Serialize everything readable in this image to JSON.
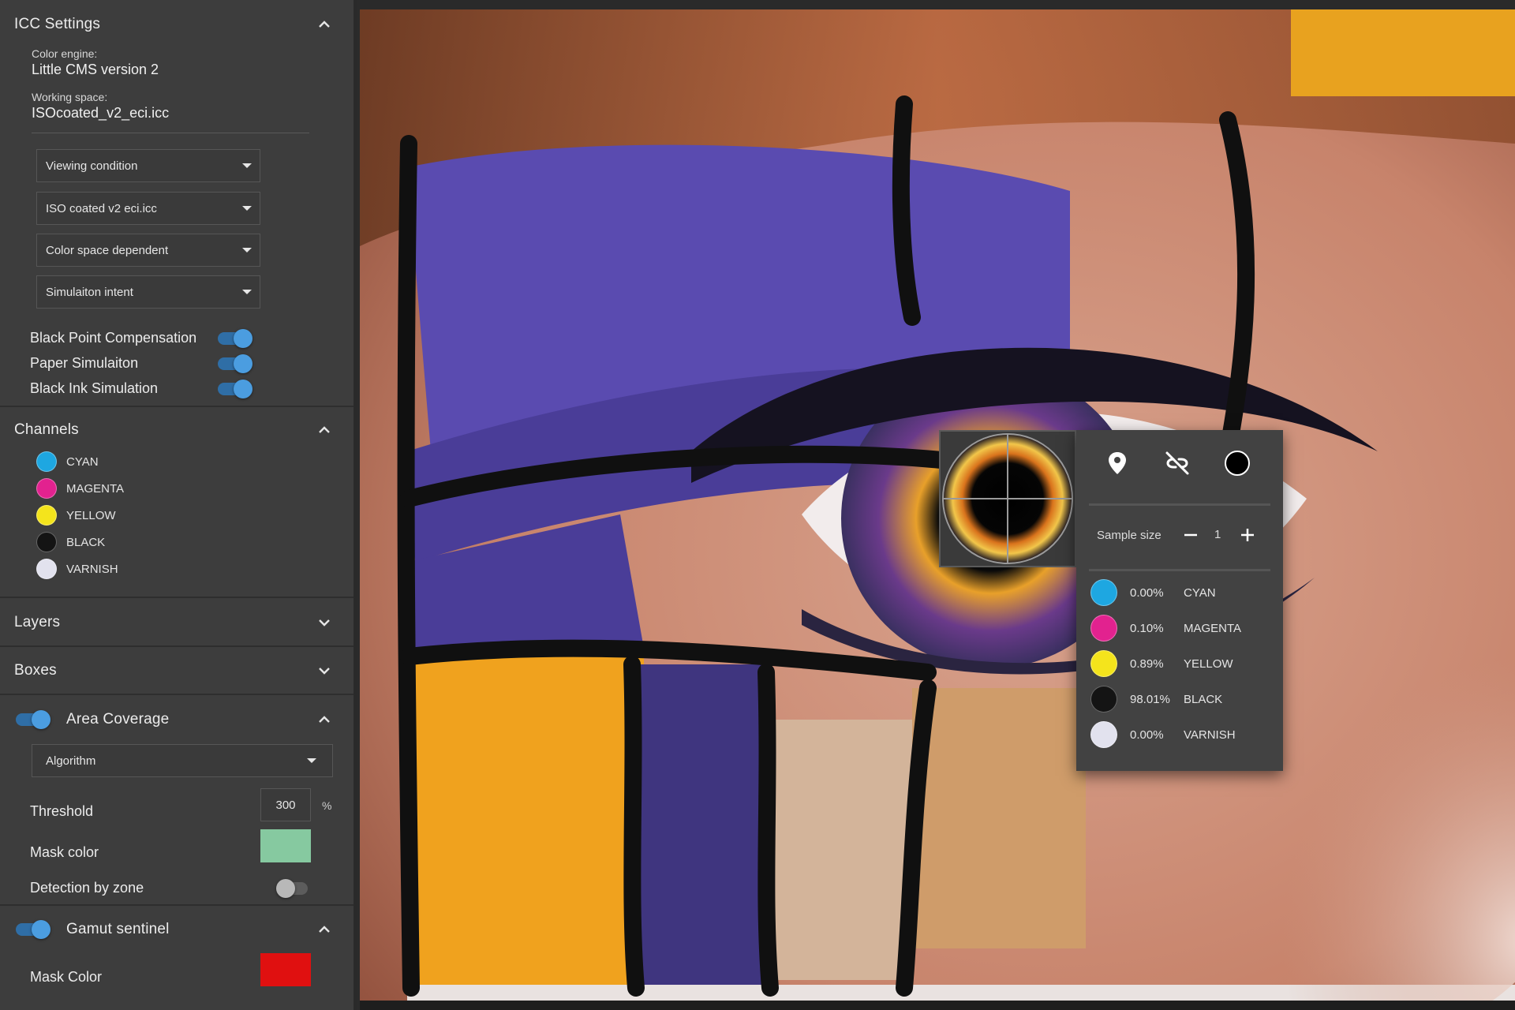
{
  "icc": {
    "title": "ICC Settings",
    "engine_label": "Color engine:",
    "engine_value": "Little CMS version 2",
    "workspace_label": "Working space:",
    "workspace_value": "ISOcoated_v2_eci.icc",
    "dropdowns": [
      "Viewing condition",
      "ISO coated v2 eci.icc",
      "Color space dependent",
      "Simulaiton intent"
    ],
    "toggles": [
      {
        "label": "Black Point Compensation",
        "on": true
      },
      {
        "label": "Paper Simulaiton",
        "on": true
      },
      {
        "label": "Black Ink Simulation",
        "on": true
      }
    ]
  },
  "channels": {
    "title": "Channels",
    "items": [
      {
        "label": "CYAN",
        "color": "#1ea7e1"
      },
      {
        "label": "MAGENTA",
        "color": "#e2228f"
      },
      {
        "label": "YELLOW",
        "color": "#f4e41c"
      },
      {
        "label": "BLACK",
        "color": "#141414"
      },
      {
        "label": "VARNISH",
        "color": "#e2e2ee"
      }
    ]
  },
  "layers": {
    "title": "Layers"
  },
  "boxes": {
    "title": "Boxes"
  },
  "area_coverage": {
    "title": "Area Coverage",
    "enabled": true,
    "algorithm": "Algorithm",
    "threshold_label": "Threshold",
    "threshold_value": "300",
    "threshold_unit": "%",
    "mask_label": "Mask color",
    "mask_color": "#86c9a0",
    "detection_label": "Detection by zone",
    "detection_on": false
  },
  "gamut": {
    "title": "Gamut sentinel",
    "enabled": true,
    "mask_label": "Mask Color",
    "mask_color": "#e01010"
  },
  "sampler": {
    "icons": [
      "location-pin-icon",
      "unlink-icon",
      "black-circle-icon"
    ],
    "sample_size_label": "Sample size",
    "sample_size_value": "1",
    "readings": [
      {
        "value": "0.00%",
        "label": "CYAN",
        "color": "#1ea7e1"
      },
      {
        "value": "0.10%",
        "label": "MAGENTA",
        "color": "#e2228f"
      },
      {
        "value": "0.89%",
        "label": "YELLOW",
        "color": "#f4e41c"
      },
      {
        "value": "98.01%",
        "label": "BLACK",
        "color": "#141414"
      },
      {
        "value": "0.00%",
        "label": "VARNISH",
        "color": "#e2e2ee"
      }
    ]
  },
  "accent": "#4b9de0"
}
